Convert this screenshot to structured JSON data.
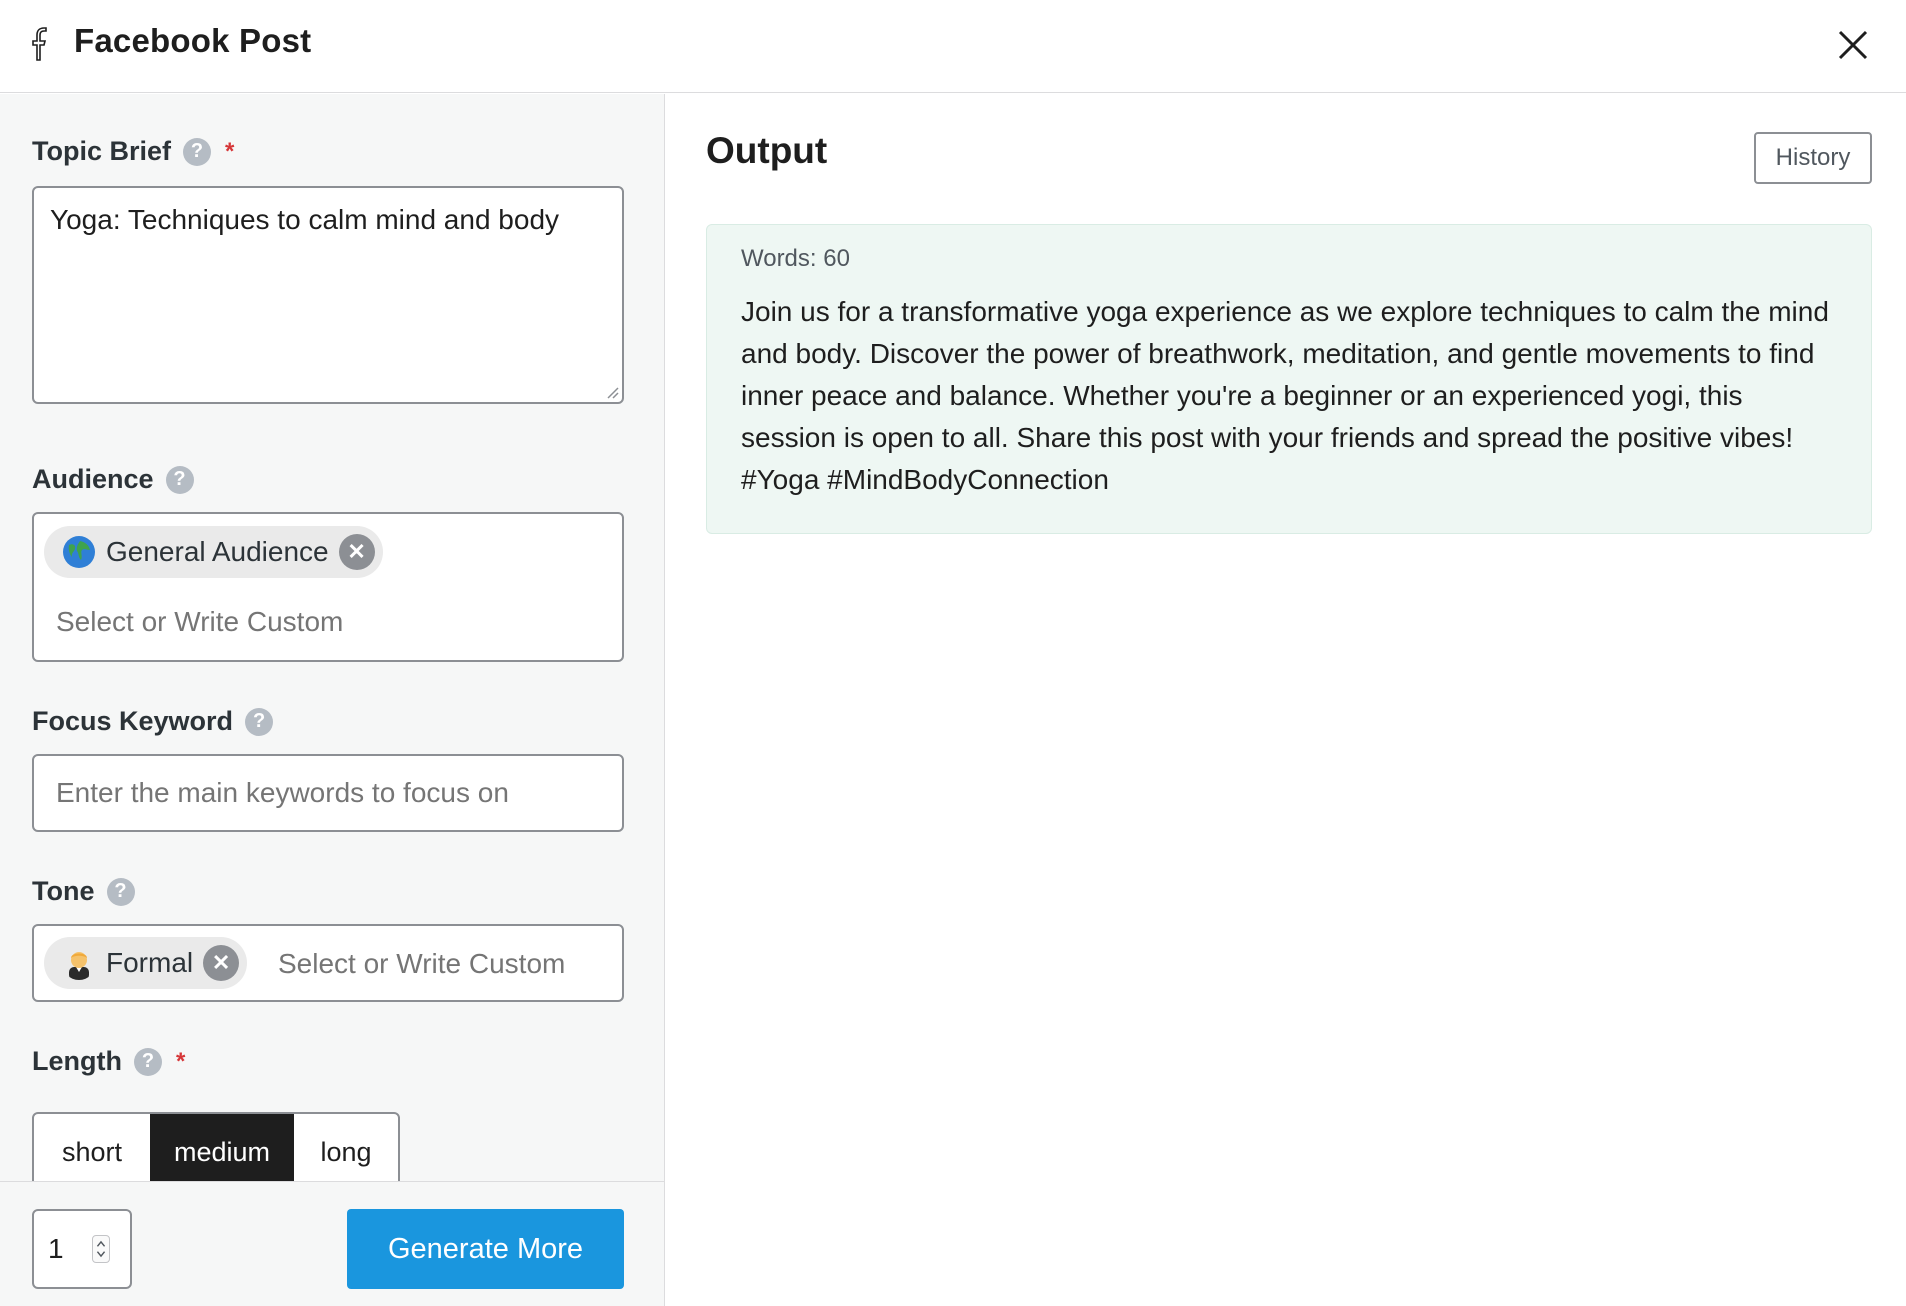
{
  "header": {
    "title": "Facebook Post"
  },
  "form": {
    "topic_brief": {
      "label": "Topic Brief",
      "required_mark": "*",
      "value": "Yoga: Techniques to calm mind and body"
    },
    "audience": {
      "label": "Audience",
      "chip_label": "General Audience",
      "placeholder": "Select or Write Custom"
    },
    "focus_keyword": {
      "label": "Focus Keyword",
      "placeholder": "Enter the main keywords to focus on"
    },
    "tone": {
      "label": "Tone",
      "chip_label": "Formal",
      "placeholder": "Select or Write Custom"
    },
    "length": {
      "label": "Length",
      "required_mark": "*",
      "options": [
        "short",
        "medium",
        "long"
      ],
      "selected": "medium"
    },
    "help_glyph": "?",
    "remove_glyph": "✕"
  },
  "footer": {
    "count_value": "1",
    "generate_label": "Generate More"
  },
  "output": {
    "title": "Output",
    "history_label": "History",
    "words_label": "Words: 60",
    "text": "Join us for a transformative yoga experience as we explore techniques to calm the mind and body. Discover the power of breathwork, meditation, and gentle movements to find inner peace and balance. Whether you're a beginner or an experienced yogi, this session is open to all. Share this post with your friends and spread the positive vibes! #Yoga #MindBodyConnection"
  },
  "colors": {
    "primary_button": "#1a96de",
    "required": "#d63638",
    "output_bg": "#eef7f3",
    "active_segment": "#1e1e1e"
  },
  "icons": [
    "facebook-icon",
    "close-icon",
    "help-icon",
    "globe-emoji-icon",
    "person-emoji-icon",
    "remove-chip-icon",
    "resize-grip-icon",
    "stepper-arrows-icon"
  ]
}
